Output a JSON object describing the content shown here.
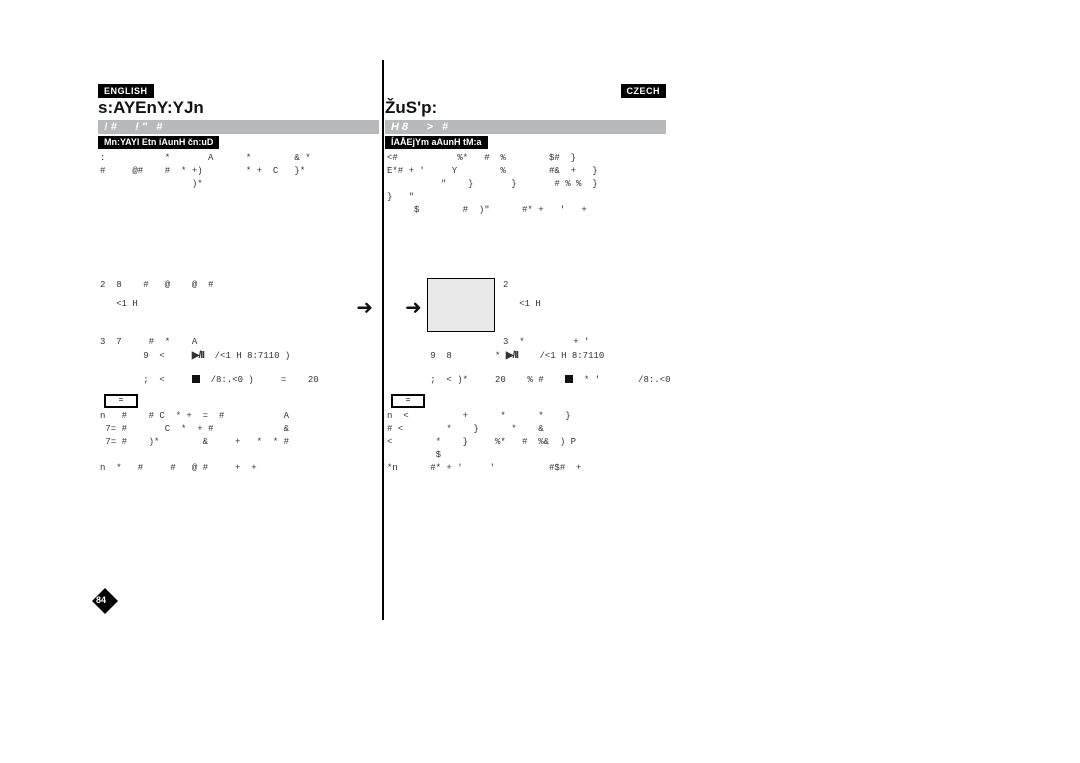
{
  "left": {
    "lang": "ENGLISH",
    "title": "s:AYEnY:YJn",
    "grey": "! #      ! \"   #",
    "black": "Mn:YAYI Etn íAunH čn:uD",
    "body1": ":           *       A      *        & *\n#     @#    #  * +)        * +  C   }*\n                 )*",
    "steps": "2  8    #   @    @  #\n   <1 H\n\n3  7     #  *    A",
    "playPrefix": "9  <     ",
    "playSuffix": "  /<1 H 8:7110 )",
    "stopPrefix": ";  <     ",
    "stopSuffix": "  /8:.<0 )     =    20",
    "noteLabel": "=",
    "notes": "n   #    # C  * +  =  #           A\n 7= #       C  *  + #             &\n 7= #    )*        &     +   *  * #\n\nn  *   #     #   @ #     +  +",
    "arrow": "➜"
  },
  "right": {
    "lang": "CZECH",
    "title": "ŽuS'p:",
    "grey": "H 8      >   #",
    "black": "ÍAÅEjYm aAunH tM:a",
    "body1": "<#           %*   #  %        $#  }\nE*# + '     Y        %        #&  +   }\n          \"    }       }       # % %  }\n}   \"\n     $        #  )\"      #* +   '   +",
    "steps": "2\n   <1 H\n\n3  *         + '",
    "playPrefix": "9  8        * ",
    "playSuffix": "    /<1 H 8:7110",
    "stopPrefix": ";  < )*     20    % #    ",
    "stopSuffix": "  * '       /8:.<0",
    "noteLabel": "=",
    "notes": "n  <          +      *      *    }\n# <        *    }      *    &\n<        *    }     %*   #  %&  ) P\n         $\n*n      #* + '     '          #$#  +",
    "arrow": "➜"
  },
  "pageNumber": "84",
  "icons": {
    "playPause": "▶/II"
  }
}
